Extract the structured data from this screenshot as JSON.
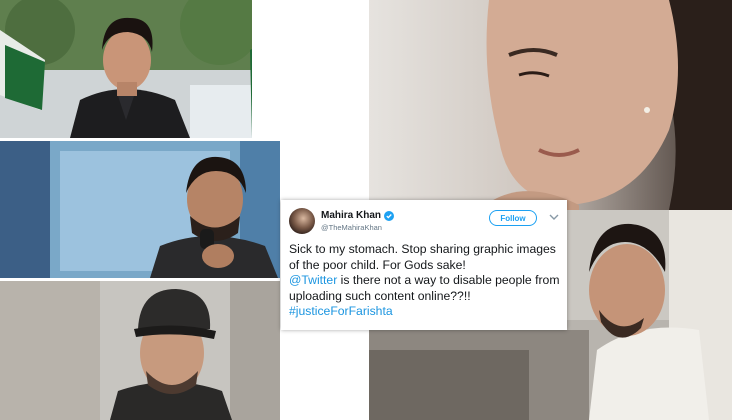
{
  "tweet": {
    "name": "Mahira Khan",
    "handle": "@TheMahiraKhan",
    "follow_label": "Follow",
    "text_1": "Sick to my stomach. Stop sharing graphic images of the poor child. For Gods sake!",
    "mention": "@Twitter",
    "text_2": " is there not a way to disable people from uploading such content online??!!",
    "hashtag": "#justiceForFarishta"
  },
  "colors": {
    "link": "#1b95e0",
    "follow": "#1da1f2",
    "verified": "#1da1f2"
  },
  "icons": [
    "verified-badge-icon",
    "chevron-down-icon"
  ]
}
